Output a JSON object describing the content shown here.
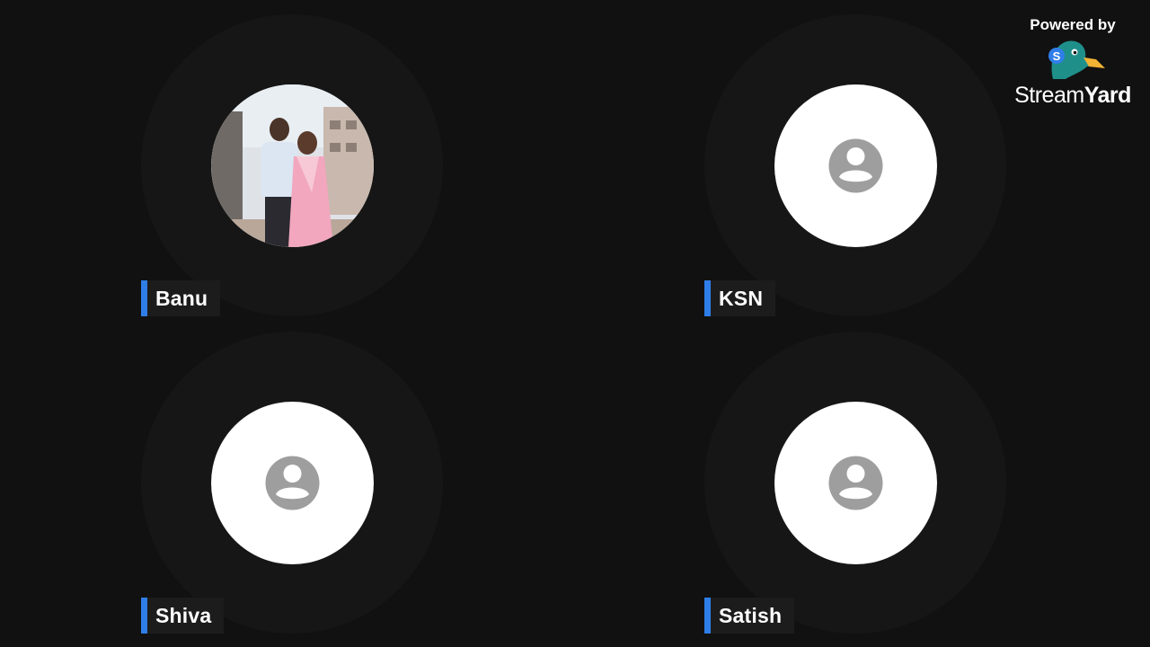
{
  "participants": [
    {
      "name": "Banu",
      "avatar": "photo-couple-icon"
    },
    {
      "name": "KSN",
      "avatar": "default-user-icon"
    },
    {
      "name": "Shiva",
      "avatar": "default-user-icon"
    },
    {
      "name": "Satish",
      "avatar": "default-user-icon"
    }
  ],
  "branding": {
    "powered_by": "Powered by",
    "wordmark_light": "Stream",
    "wordmark_bold": "Yard",
    "logo_icon": "streamyard-duck-logo"
  },
  "colors": {
    "background": "#111111",
    "nameplate_accent": "#2f7ee8",
    "avatar_placeholder": "#9e9e9e"
  }
}
